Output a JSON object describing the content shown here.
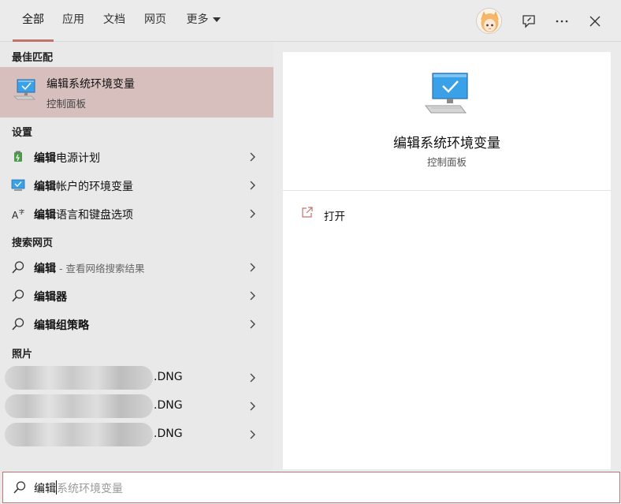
{
  "tabs": [
    {
      "label": "全部",
      "active": true
    },
    {
      "label": "应用",
      "active": false
    },
    {
      "label": "文档",
      "active": false
    },
    {
      "label": "网页",
      "active": false
    },
    {
      "label": "更多",
      "active": false
    }
  ],
  "sections": {
    "best_match": "最佳匹配",
    "settings": "设置",
    "web_search": "搜索网页",
    "photos": "照片"
  },
  "best_match": {
    "title": "编辑系统环境变量",
    "subtitle": "控制面板"
  },
  "settings_items": [
    {
      "bold": "编辑",
      "rest": "电源计划",
      "icon": "power-plan-icon"
    },
    {
      "bold": "编辑",
      "rest": "帐户的环境变量",
      "icon": "monitor-icon"
    },
    {
      "bold": "编辑",
      "rest": "语言和键盘选项",
      "icon": "language-icon"
    }
  ],
  "web_items": [
    {
      "bold": "编辑",
      "rest": "",
      "sub": " - 查看网络搜索结果"
    },
    {
      "bold": "编辑",
      "rest": "器",
      "sub": ""
    },
    {
      "bold": "编辑",
      "rest": "组策略",
      "sub": ""
    }
  ],
  "photo_items": [
    {
      "ext": ".DNG"
    },
    {
      "ext": ".DNG"
    },
    {
      "ext": ".DNG"
    }
  ],
  "preview": {
    "title": "编辑系统环境变量",
    "subtitle": "控制面板",
    "open_label": "打开"
  },
  "search": {
    "typed": "编辑",
    "suggestion": "系统环境变量"
  },
  "colors": {
    "accent": "#c07470",
    "best_match_bg": "#d7bfbe"
  }
}
